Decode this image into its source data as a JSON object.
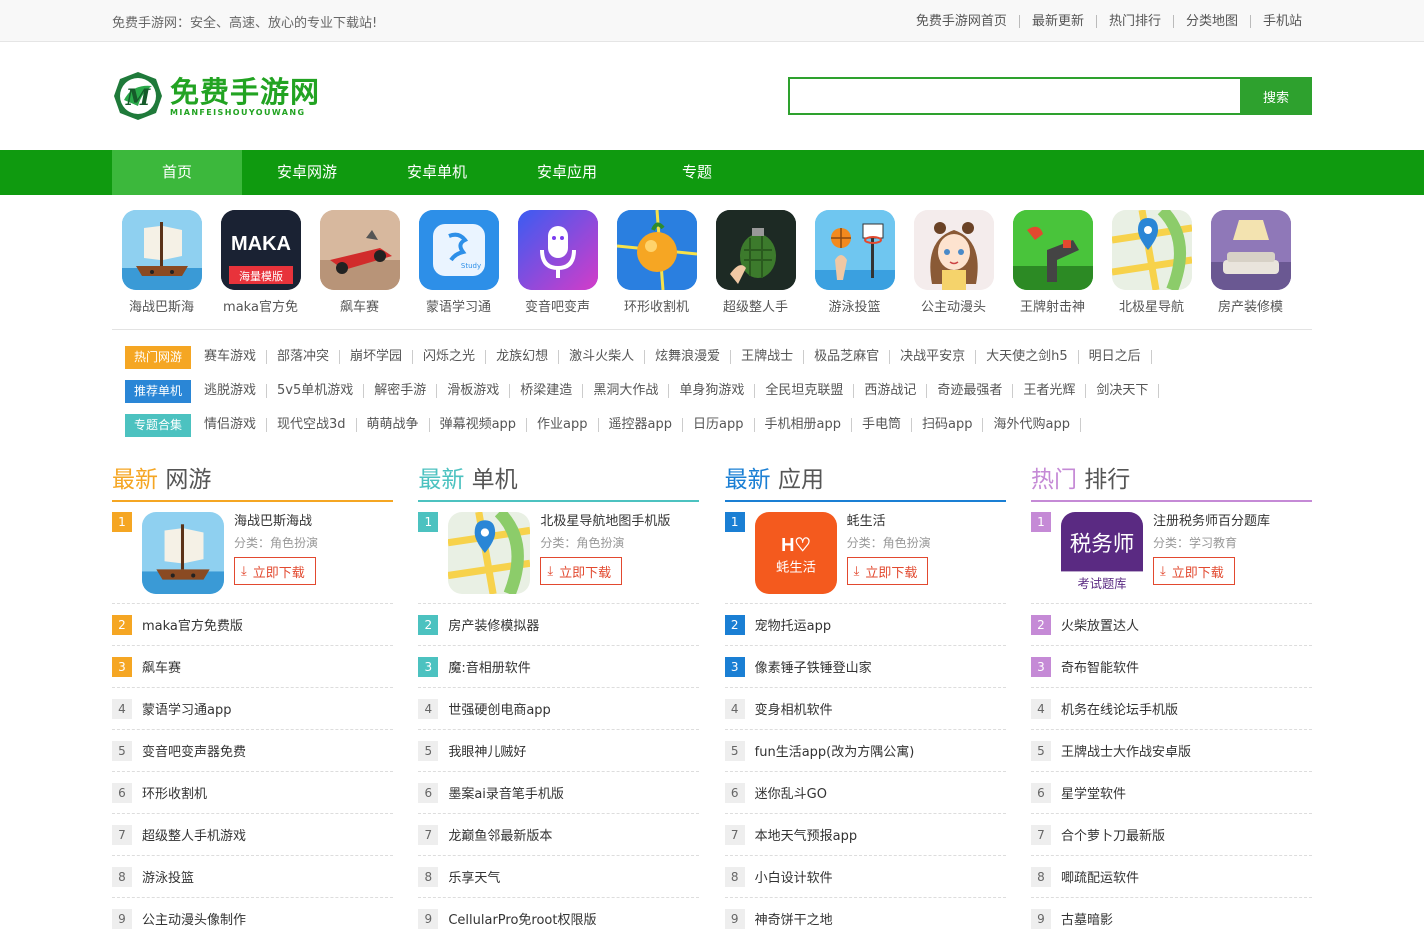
{
  "topbar": {
    "slogan": "免费手游网：安全、高速、放心的专业下载站!",
    "links": [
      "免费手游网首页",
      "最新更新",
      "热门排行",
      "分类地图",
      "手机站"
    ]
  },
  "header": {
    "logo_title": "免费手游网",
    "logo_sub": "MIANFEISHOUYOUWANG",
    "logo_letter": "M",
    "search_placeholder": "",
    "search_button": "搜索"
  },
  "nav": [
    "首页",
    "安卓网游",
    "安卓单机",
    "安卓应用",
    "专题"
  ],
  "apps": [
    {
      "name": "海战巴斯海",
      "icon": "ship-icon",
      "bg": "#7ec3ea"
    },
    {
      "name": "maka官方免",
      "icon": "maka-icon",
      "bg": "#1a2233",
      "label": "MAKA",
      "badge": "海量模版"
    },
    {
      "name": "飙车赛",
      "icon": "car-icon",
      "bg": "#d0b096"
    },
    {
      "name": "蒙语学习通",
      "icon": "study-icon",
      "bg": "#2d8fe8",
      "label": "Study"
    },
    {
      "name": "变音吧变声",
      "icon": "mic-icon",
      "bg": "#7a3cf0"
    },
    {
      "name": "环形收割机",
      "icon": "fruit-icon",
      "bg": "#2a7fe0"
    },
    {
      "name": "超级整人手",
      "icon": "grenade-icon",
      "bg": "#1d2a24"
    },
    {
      "name": "游泳投篮",
      "icon": "basketball-icon",
      "bg": "#6fc6f0"
    },
    {
      "name": "公主动漫头",
      "icon": "anime-icon",
      "bg": "#f4ecec"
    },
    {
      "name": "王牌射击神",
      "icon": "gun-icon",
      "bg": "#49c43b"
    },
    {
      "name": "北极星导航",
      "icon": "map-icon",
      "bg": "#e9f0e4"
    },
    {
      "name": "房产装修模",
      "icon": "room-icon",
      "bg": "#8f78b8"
    }
  ],
  "tag_rows": [
    {
      "label": "热门网游",
      "color": "#f5a623",
      "items": [
        "赛车游戏",
        "部落冲突",
        "崩坏学园",
        "闪烁之光",
        "龙族幻想",
        "激斗火柴人",
        "炫舞浪漫爱",
        "王牌战士",
        "极品芝麻官",
        "决战平安京",
        "大天使之剑h5",
        "明日之后"
      ]
    },
    {
      "label": "推荐单机",
      "color": "#2a86d6",
      "items": [
        "逃脱游戏",
        "5v5单机游戏",
        "解密手游",
        "滑板游戏",
        "桥梁建造",
        "黑洞大作战",
        "单身狗游戏",
        "全民坦克联盟",
        "西游战记",
        "奇迹最强者",
        "王者光辉",
        "剑决天下"
      ]
    },
    {
      "label": "专题合集",
      "color": "#4cc2c0",
      "items": [
        "情侣游戏",
        "现代空战3d",
        "萌萌战争",
        "弹幕视频app",
        "作业app",
        "遥控器app",
        "日历app",
        "手机相册app",
        "手电筒",
        "扫码app",
        "海外代购app"
      ]
    }
  ],
  "download_label": "立即下载",
  "columns": [
    {
      "title_em": "最新",
      "title_rest": "网游",
      "color": "#f5a623",
      "first": {
        "name": "海战巴斯海战",
        "cat": "分类：角色扮演",
        "icon": "ship-icon"
      },
      "items": [
        "maka官方免费版",
        "飙车赛",
        "蒙语学习通app",
        "变音吧变声器免费",
        "环形收割机",
        "超级整人手机游戏",
        "游泳投篮",
        "公主动漫头像制作"
      ]
    },
    {
      "title_em": "最新",
      "title_rest": "单机",
      "color": "#4cc2c0",
      "first": {
        "name": "北极星导航地图手机版",
        "cat": "分类：角色扮演",
        "icon": "map-icon"
      },
      "items": [
        "房产装修模拟器",
        "魔:音相册软件",
        "世强硬创电商app",
        "我眼神儿贼好",
        "墨案ai录音笔手机版",
        "龙巅鱼邻最新版本",
        "乐享天气",
        "CellularPro免root权限版"
      ]
    },
    {
      "title_em": "最新",
      "title_rest": "应用",
      "color": "#1a7fd4",
      "first": {
        "name": "蚝生活",
        "cat": "分类：角色扮演",
        "icon": "hao-icon",
        "label": "蚝生活"
      },
      "items": [
        "宠物托运app",
        "像素锤子铁锤登山家",
        "变身相机软件",
        "fun生活app(改为方隅公寓)",
        "迷你乱斗GO",
        "本地天气预报app",
        "小白设计软件",
        "神奇饼干之地"
      ]
    },
    {
      "title_em": "热门",
      "title_rest": "排行",
      "color": "#c58ad6",
      "first": {
        "name": "注册税务师百分题库",
        "cat": "分类：学习教育",
        "icon": "tax-icon",
        "label": "税务师",
        "sub": "考试题库"
      },
      "items": [
        "火柴放置达人",
        "奇布智能软件",
        "机务在线论坛手机版",
        "王牌战士大作战安卓版",
        "星学堂软件",
        "合个萝卜刀最新版",
        "唧疏配运软件",
        "古墓暗影"
      ]
    }
  ]
}
